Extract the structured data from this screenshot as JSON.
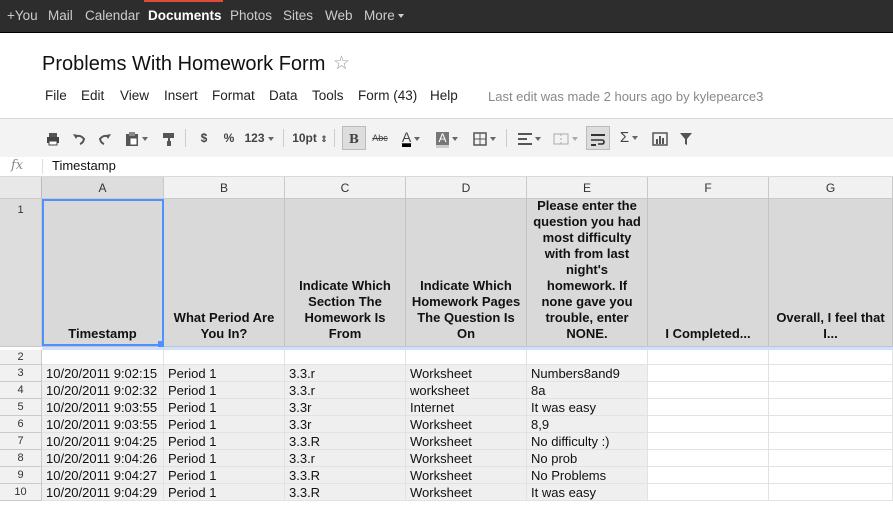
{
  "gbar": {
    "items": [
      {
        "label": "+You",
        "selected": false
      },
      {
        "label": "Mail",
        "selected": false
      },
      {
        "label": "Calendar",
        "selected": false
      },
      {
        "label": "Documents",
        "selected": true
      },
      {
        "label": "Photos",
        "selected": false
      },
      {
        "label": "Sites",
        "selected": false
      },
      {
        "label": "Web",
        "selected": false
      },
      {
        "label": "More",
        "selected": false
      }
    ],
    "accent_color": "#dd4b39"
  },
  "document": {
    "title": "Problems With Homework Form",
    "last_edit": "Last edit was made 2 hours ago by kylepearce3"
  },
  "menu": [
    "File",
    "Edit",
    "View",
    "Insert",
    "Format",
    "Data",
    "Tools",
    "Form (43)",
    "Help"
  ],
  "toolbar": {
    "currency": "$",
    "percent": "%",
    "number_format": "123",
    "font_size": "10pt",
    "bold": "B",
    "strike": "Abc",
    "text_color": "A",
    "fill_color": "A",
    "sum": "Σ"
  },
  "formula_bar": {
    "fx_label": "fx",
    "value": "Timestamp"
  },
  "grid": {
    "columns": [
      "A",
      "B",
      "C",
      "D",
      "E",
      "F",
      "G"
    ],
    "selected_cell": "A1",
    "headers": [
      "Timestamp",
      "What Period Are You In?",
      "Indicate Which Section The Homework Is From",
      "Indicate Which Homework Pages The Question Is On",
      "Please enter the question you had most difficulty with from last night's homework. If none gave you trouble, enter NONE.",
      "I Completed...",
      "Overall, I feel that I..."
    ],
    "rows": [
      {
        "num": "2",
        "cells": [
          "",
          "",
          "",
          "",
          "",
          "",
          ""
        ]
      },
      {
        "num": "3",
        "cells": [
          "10/20/2011 9:02:15",
          "Period 1",
          "3.3.r",
          "Worksheet",
          "Numbers8and9",
          "",
          ""
        ]
      },
      {
        "num": "4",
        "cells": [
          "10/20/2011 9:02:32",
          "Period 1",
          "3.3.r",
          "worksheet",
          "8a",
          "",
          ""
        ]
      },
      {
        "num": "5",
        "cells": [
          "10/20/2011 9:03:55",
          "Period 1",
          "3.3r",
          "Internet",
          "It was easy",
          "",
          ""
        ]
      },
      {
        "num": "6",
        "cells": [
          "10/20/2011 9:03:55",
          "Period 1",
          "3.3r",
          "Worksheet",
          "8,9",
          "",
          ""
        ]
      },
      {
        "num": "7",
        "cells": [
          "10/20/2011 9:04:25",
          "Period 1",
          "3.3.R",
          "Worksheet",
          "No difficulty :)",
          "",
          ""
        ]
      },
      {
        "num": "8",
        "cells": [
          "10/20/2011 9:04:26",
          "Period 1",
          "3.3.r",
          "Worksheet",
          "No prob",
          "",
          ""
        ]
      },
      {
        "num": "9",
        "cells": [
          "10/20/2011 9:04:27",
          "Period 1",
          "3.3.R",
          "Worksheet",
          "No Problems",
          "",
          ""
        ]
      },
      {
        "num": "10",
        "cells": [
          "10/20/2011 9:04:29",
          "Period 1",
          "3.3.R",
          "Worksheet",
          "It was easy",
          "",
          ""
        ]
      }
    ],
    "header_row_num": "1"
  }
}
